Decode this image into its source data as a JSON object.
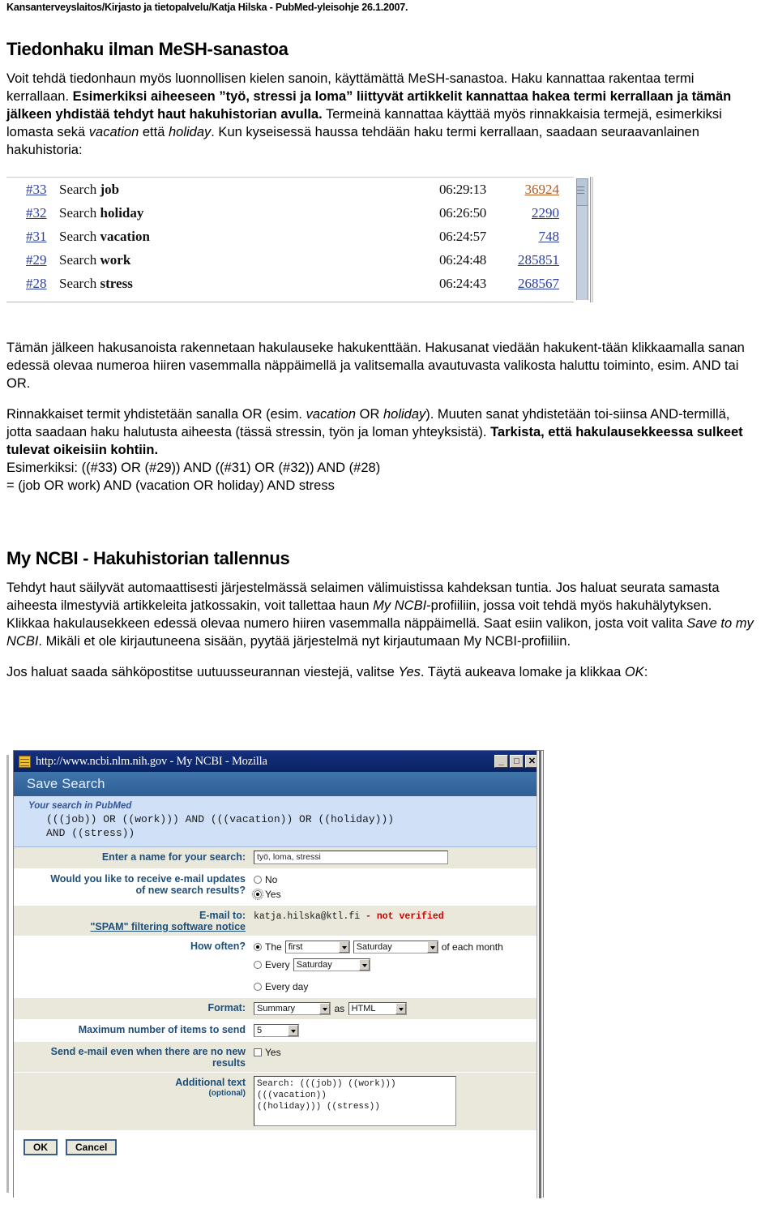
{
  "doc_header": "Kansanterveyslaitos/Kirjasto ja tietopalvelu/Katja Hilska - PubMed-yleisohje 26.1.2007.",
  "sections": {
    "title1": "Tiedonhaku ilman MeSH-sanastoa",
    "intro_1": "Voit tehdä tiedonhaun myös luonnollisen kielen sanoin, käyttämättä MeSH-sanastoa. Haku kannattaa rakentaa termi kerrallaan. ",
    "intro_bold": "Esimerkiksi aiheeseen ”työ, stressi ja loma” liittyvät artikkelit kannattaa hakea termi kerrallaan ja tämän jälkeen yhdistää tehdyt haut hakuhistorian avulla.",
    "intro_2": " Termeinä kannattaa käyttää myös rinnakkaisia termejä, esimerkiksi lomasta sekä ",
    "intro_it1": "vacation",
    "intro_3": " että ",
    "intro_it2": "holiday",
    "intro_4": ". Kun kyseisessä haussa tehdään haku termi kerrallaan, saadaan seuraavanlainen hakuhistoria:",
    "after_1": "Tämän jälkeen hakusanoista rakennetaan hakulauseke hakukenttään. Hakusanat viedään hakukent-tään klikkaamalla sanan edessä olevaa numeroa hiiren vasemmalla näppäimellä ja valitsemalla avautuvasta valikosta haluttu toiminto, esim. AND tai OR.",
    "after_2a": "Rinnakkaiset termit yhdistetään sanalla OR (esim. ",
    "after_2it1": "vacation",
    "after_2b": " OR ",
    "after_2it2": "holiday",
    "after_2c": "). Muuten sanat yhdistetään toi-siinsa AND-termillä, jotta saadaan haku halutusta aiheesta (tässä stressin, työn ja loman yhteyksistä). ",
    "after_2bold": "Tarkista, että hakulausekkeessa sulkeet tulevat oikeisiin kohtiin.",
    "example_line1": "Esimerkiksi: ((#33) OR (#29)) AND ((#31) OR (#32)) AND (#28)",
    "example_line2": "= (job OR work) AND (vacation OR holiday) AND stress",
    "title2": "My NCBI - Hakuhistorian tallennus",
    "ncbi_1": "Tehdyt haut säilyvät automaattisesti järjestelmässä selaimen välimuistissa kahdeksan tuntia. Jos haluat seurata samasta aiheesta ilmestyviä artikkeleita jatkossakin, voit tallettaa haun ",
    "ncbi_it1": "My NCBI",
    "ncbi_2": "-profiiliin, jossa voit tehdä myös hakuhälytyksen. Klikkaa hakulausekkeen edessä olevaa numero hiiren vasemmalla näppäimellä. Saat esiin valikon, josta voit valita ",
    "ncbi_it2": "Save to my NCBI",
    "ncbi_3": ". Mikäli et ole kirjautuneena sisään, pyytää järjestelmä nyt kirjautumaan My NCBI-profiiliin.",
    "email_1": "Jos haluat saada sähköpostitse uutuusseurannan viestejä, valitse ",
    "email_it1": "Yes",
    "email_2": ". Täytä aukeava lomake ja klikkaa ",
    "email_it2": "OK",
    "email_3": ":"
  },
  "search_history": {
    "rows": [
      {
        "num": "#33",
        "action": "Search",
        "term": "job",
        "time": "06:29:13",
        "count": "36924",
        "visited": true
      },
      {
        "num": "#32",
        "action": "Search",
        "term": "holiday",
        "time": "06:26:50",
        "count": "2290",
        "visited": false
      },
      {
        "num": "#31",
        "action": "Search",
        "term": "vacation",
        "time": "06:24:57",
        "count": "748",
        "visited": false
      },
      {
        "num": "#29",
        "action": "Search",
        "term": "work",
        "time": "06:24:48",
        "count": "285851",
        "visited": false
      },
      {
        "num": "#28",
        "action": "Search",
        "term": "stress",
        "time": "06:24:43",
        "count": "268567",
        "visited": false
      }
    ],
    "link_color": "#2b3fa0",
    "visited_color": "#b55a20"
  },
  "mozilla_window": {
    "title": "http://www.ncbi.nlm.nih.gov - My NCBI - Mozilla",
    "minimize": "_",
    "maximize": "□",
    "close": "✕",
    "page_header": "Save Search",
    "query_label": "Your search in PubMed",
    "query_text": "(((job)) OR ((work))) AND (((vacation)) OR ((holiday)))\nAND ((stress))",
    "fields": {
      "name_label": "Enter a name for your search:",
      "name_value": "työ, loma, stressi",
      "email_updates_label_line1": "Would you like to receive e-mail updates",
      "email_updates_label_line2": "of new search results?",
      "radio_no": "No",
      "radio_yes": "Yes",
      "email_to_label": "E-mail to:",
      "spam_notice_link": "\"SPAM\" filtering software notice",
      "email_address": "katja.hilska@ktl.fi",
      "email_status": "- not verified",
      "how_often_label": "How often?",
      "opt_the": "The",
      "opt_ordinal": "first",
      "opt_weekday": "Saturday",
      "opt_of_each_month": "of each month",
      "opt_every": "Every",
      "opt_every_weekday": "Saturday",
      "opt_every_day": "Every day",
      "format_label": "Format:",
      "format_value": "Summary",
      "format_as": "as",
      "format_type": "HTML",
      "max_items_label": "Maximum number of items to send",
      "max_items_value": "5",
      "send_empty_label_line1": "Send e-mail even when there are no new",
      "send_empty_label_line2": "results",
      "send_empty_yes": "Yes",
      "additional_label": "Additional text",
      "additional_sub": "(optional)",
      "additional_value": "Search: (((job)) ((work))) (((vacation))\n((holiday))) ((stress))"
    },
    "buttons": {
      "ok": "OK",
      "cancel": "Cancel"
    }
  }
}
